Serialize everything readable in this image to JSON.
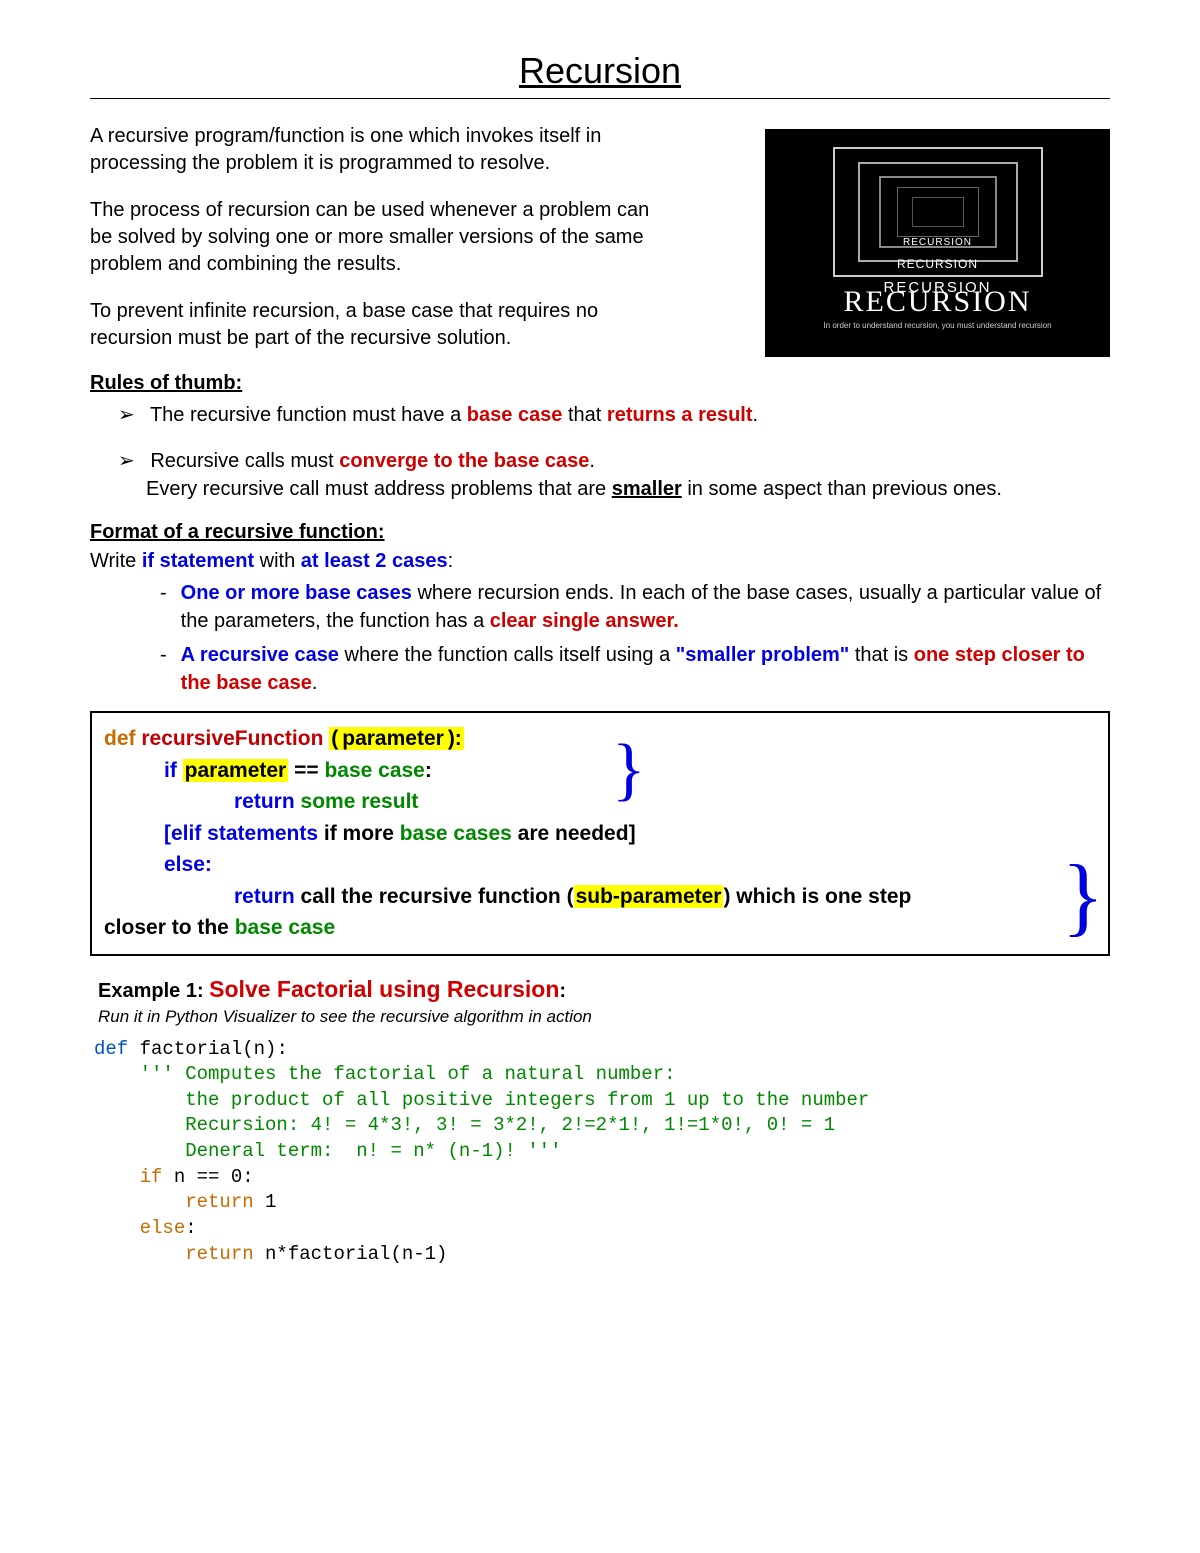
{
  "title": "Recursion",
  "intro": {
    "p1": "A recursive program/function is one which invokes itself in processing the problem it is programmed to resolve.",
    "p2": "The process of recursion can be used whenever a problem can be solved by solving one or more smaller versions of the same problem and combining the results.",
    "p3": "To prevent infinite recursion, a base case that requires no recursion must be part of the recursive solution."
  },
  "poster": {
    "word": "RECURSION",
    "tagline": "In order to understand recursion, you must understand recursion"
  },
  "rules_head": "Rules of thumb:",
  "rule1_a": "The recursive function must have a ",
  "rule1_b": "base case",
  "rule1_c": " that ",
  "rule1_d": "returns a result",
  "rule1_e": ".",
  "rule2_a": "Recursive calls must ",
  "rule2_b": "converge to the base case",
  "rule2_c": ".",
  "rule2_sub_a": "Every recursive call must address problems that are ",
  "rule2_sub_b": "smaller",
  "rule2_sub_c": " in some aspect than previous ones.",
  "format_head": "Format of a recursive function:",
  "format_intro_a": "Write ",
  "format_intro_b": "if statement",
  "format_intro_c": " with ",
  "format_intro_d": "at least 2 cases",
  "format_intro_e": ":",
  "fmt1_a": "One or more base cases",
  "fmt1_b": " where recursion ends. In each of the base cases, usually a particular value of the parameters, the function has a ",
  "fmt1_c": "clear single answer.",
  "fmt2_a": "A recursive case",
  "fmt2_b": " where the function calls itself using a ",
  "fmt2_c": "\"smaller problem\"",
  "fmt2_d": " that is ",
  "fmt2_e": "one step closer to the base case",
  "fmt2_f": ".",
  "code": {
    "def": "def",
    "name": "recursiveFunction",
    "param_open": "(",
    "param": "parameter",
    "param_close": "):",
    "if_kw": "if ",
    "param2": "parameter",
    "eq": " == ",
    "base": "base case",
    "colon": ":",
    "return1": "return ",
    "result": "some result",
    "elif_open": "[elif statements",
    "elif_mid": "  if more ",
    "elif_bc": "base cases",
    "elif_end": " are needed]",
    "else_kw": "else:",
    "return2": "return ",
    "call_a": "call the recursive function (",
    "subp": "sub-parameter",
    "call_b": ") which is one step",
    "closer_a": "closer to the ",
    "closer_b": "base case"
  },
  "example": {
    "label": "Example 1: ",
    "title": "Solve Factorial using Recursion",
    "colon": ":",
    "sub": "Run it in Python Visualizer to see the recursive algorithm in action",
    "py": {
      "l1_def": "def ",
      "l1_name": "factorial",
      "l1_paren": "(n):",
      "c1": "    ''' Computes the factorial of a natural number:",
      "c2": "        the product of all positive integers from 1 up to the number",
      "c3": "        Recursion: 4! = 4*3!, 3! = 3*2!, 2!=2*1!, 1!=1*0!, 0! = 1",
      "c4": "        Deneral term:  n! = n* (n-1)! '''",
      "l5": "    if",
      "l5b": " n == 0:",
      "l6": "        return ",
      "l6b": "1",
      "l7": "    else",
      "l7b": ":",
      "l8": "        return ",
      "l8b": "n*factorial(n-1)"
    }
  }
}
